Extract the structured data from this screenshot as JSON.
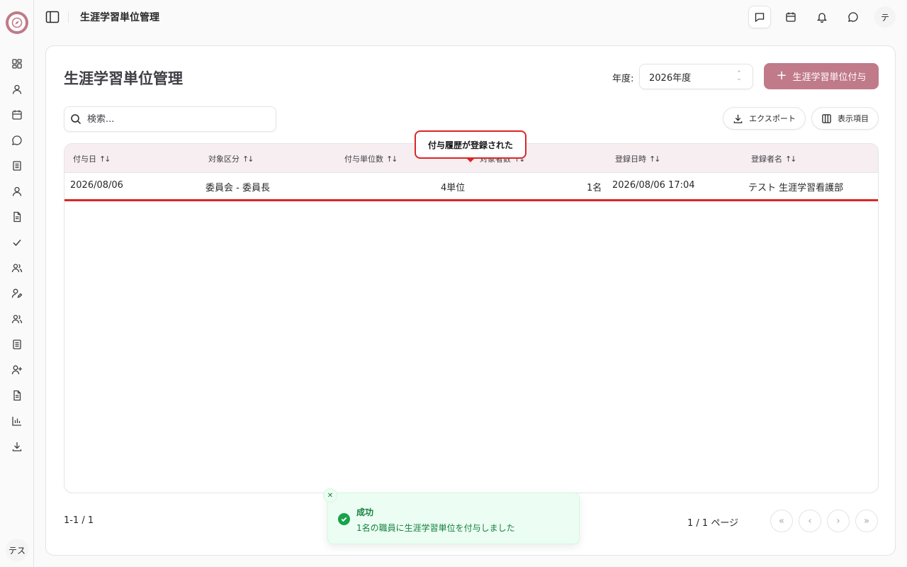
{
  "app": {
    "header_title": "生涯学習単位管理",
    "user_initial_sidebar": "テス",
    "user_initial_header": "テ"
  },
  "page": {
    "title": "生涯学習単位管理",
    "year_label": "年度:",
    "year_value": "2026年度",
    "add_button": "生涯学習単位付与",
    "search_placeholder": "検索...",
    "export_button": "エクスポート",
    "columns_button": "表示項目"
  },
  "table": {
    "columns": [
      {
        "label": "付与日",
        "sort": "↑↓"
      },
      {
        "label": "対象区分",
        "sort": "↑↓"
      },
      {
        "label": "付与単位数",
        "sort": "↑↓"
      },
      {
        "label": "対象者数",
        "sort": "↑↓"
      },
      {
        "label": "登録日時",
        "sort": "↑↓"
      },
      {
        "label": "登録者名",
        "sort": "↑↓"
      }
    ],
    "rows": [
      [
        "2026/08/06",
        "委員会 - 委員長",
        "4単位",
        "1名",
        "2026/08/06 17:04",
        "テスト 生涯学習看護部"
      ]
    ]
  },
  "callout": "付与履歴が登録された",
  "footer": {
    "range": "1-1 / 1",
    "page_info": "1 / 1 ページ"
  },
  "toast": {
    "title": "成功",
    "message": "1名の職員に生涯学習単位を付与しました"
  },
  "colors": {
    "accent": "#c07a8a",
    "highlight": "#dc2626",
    "success": "#16a34a"
  }
}
